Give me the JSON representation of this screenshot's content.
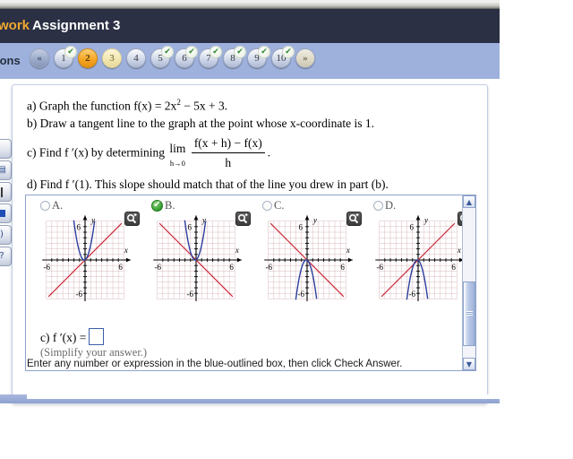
{
  "header": {
    "brand_tail": "work",
    "assignment_title": "Assignment 3"
  },
  "nav": {
    "label": "ions",
    "prev_glyph": "«",
    "next_glyph": "»",
    "check_glyph": "✔",
    "items": [
      {
        "num": "1",
        "state": "done",
        "checked": true
      },
      {
        "num": "2",
        "state": "current",
        "checked": false
      },
      {
        "num": "3",
        "state": "pending",
        "checked": false
      },
      {
        "num": "4",
        "state": "plain",
        "checked": false
      },
      {
        "num": "5",
        "state": "done",
        "checked": true
      },
      {
        "num": "6",
        "state": "done",
        "checked": true
      },
      {
        "num": "7",
        "state": "done",
        "checked": true
      },
      {
        "num": "8",
        "state": "done",
        "checked": true
      },
      {
        "num": "9",
        "state": "done",
        "checked": true
      },
      {
        "num": "10",
        "state": "done",
        "checked": true
      }
    ]
  },
  "side_toolbar": {
    "items": [
      {
        "name": "blank-tool",
        "glyph": ""
      },
      {
        "name": "calculator-tool",
        "glyph": "▤"
      },
      {
        "name": "ruler-tool",
        "glyph": "|"
      },
      {
        "name": "square-tool",
        "glyph": "■"
      },
      {
        "name": "speaker-tool",
        "glyph": ")"
      },
      {
        "name": "help-tool",
        "glyph": "?"
      }
    ]
  },
  "question": {
    "part_a": "a) Graph the function f(x) = 2x",
    "part_a_exp": "2",
    "part_a_rest": " − 5x + 3.",
    "part_b": "b) Draw a tangent line to the graph at the point whose x-coordinate is 1.",
    "part_c_pre": "c) Find f ′(x) by determining",
    "lim_word": "lim",
    "lim_sub": "h→0",
    "frac_num": "f(x + h) − f(x)",
    "frac_den": "h",
    "part_c_post": ".",
    "part_d": "d) Find f ′(1). This slope should match that of the line you drew in part (b)."
  },
  "options": {
    "zoom_icon": "magnifier-plus-icon",
    "choices": [
      {
        "label": "A.",
        "selected": false,
        "parabola": "up",
        "line": "up"
      },
      {
        "label": "B.",
        "selected": true,
        "parabola": "up",
        "line": "down"
      },
      {
        "label": "C.",
        "selected": false,
        "parabola": "down",
        "line": "down"
      },
      {
        "label": "D.",
        "selected": false,
        "parabola": "down",
        "line": "up"
      }
    ],
    "axis": {
      "x_label": "x",
      "y_label": "y",
      "x_min_tick": "-6",
      "x_max_tick": "6",
      "y_max_tick": "6",
      "y_min_tick": "-6"
    },
    "scrollbar": {
      "up_glyph": "▲",
      "down_glyph": "▼"
    }
  },
  "answer": {
    "prefix": "c) f ′(x) =",
    "value": "",
    "hint": "(Simplify your answer.)"
  },
  "footer": {
    "instruction": "Enter any number or expression in the blue-outlined box, then click Check Answer."
  }
}
